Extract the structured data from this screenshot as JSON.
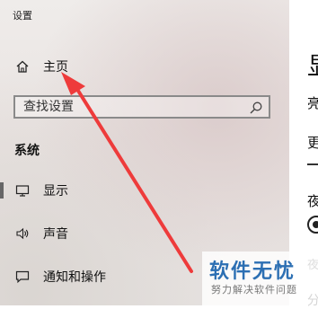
{
  "app": {
    "title": "设置"
  },
  "nav": {
    "home": {
      "label": "主页",
      "icon": "home-icon"
    },
    "display": {
      "label": "显示",
      "icon": "monitor-icon"
    },
    "sound": {
      "label": "声音",
      "icon": "speaker-icon"
    },
    "notifications": {
      "label": "通知和操作",
      "icon": "notification-icon"
    }
  },
  "search": {
    "placeholder": "查找设置",
    "icon": "search-icon"
  },
  "section": {
    "label": "系统"
  },
  "content": {
    "heading": "显",
    "line1": "亮",
    "line2": "更",
    "line3": "夜",
    "line4": "夜",
    "line5": "分"
  },
  "watermark": {
    "main": "软件无忧",
    "sub": "努力解决软件问题"
  },
  "colors": {
    "annotation_arrow": "#ee3b3b",
    "watermark_blue": "#2c6fb3"
  }
}
